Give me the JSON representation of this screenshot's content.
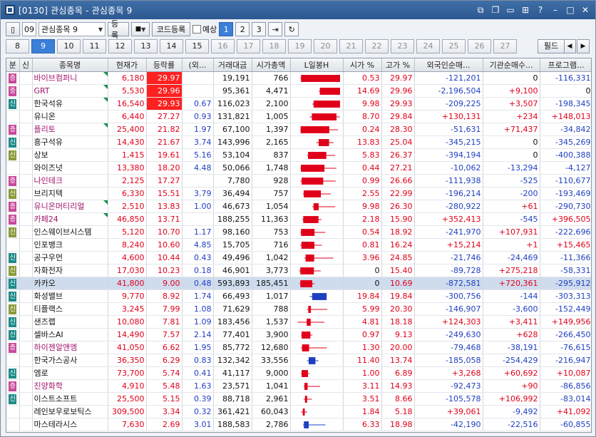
{
  "window": {
    "title": "[0130] 관심종목 - 관심종목 9"
  },
  "toolbar": {
    "group_no": "09",
    "group_name": "관심종목 9",
    "register_btn": "등록",
    "code_register_btn": "코드등록",
    "preview_label": "예상",
    "pages": [
      "1",
      "2",
      "3"
    ]
  },
  "tabs": [
    "8",
    "9",
    "10",
    "11",
    "12",
    "13",
    "14",
    "15",
    "16",
    "17",
    "18",
    "19",
    "20",
    "21",
    "22",
    "23",
    "24",
    "25",
    "26",
    "27"
  ],
  "filter_label": "필드",
  "colors": {
    "up": "#e0001a",
    "down": "#1f3fc0",
    "active": "#3b7fd9",
    "selected_row": "#cfdcee"
  },
  "columns": [
    "분",
    "신",
    "종목명",
    "현재가",
    "등락률",
    "(외...",
    "거래대금",
    "시가총액",
    "L일봉H",
    "시가 %",
    "고가 %",
    "외국인순매...",
    "기관순매수...",
    "프로그램..."
  ],
  "rows": [
    {
      "b": "증",
      "s": "",
      "name": "바이브컴퍼니",
      "price": "6,180",
      "rate": "29.97",
      "f": "",
      "amt": "19,191",
      "cap": "766",
      "o": "0.53",
      "h": "29.97",
      "fr": "-121,201",
      "inst": "0",
      "prog": "-116,331",
      "ohlc": [
        0.53,
        29.97,
        0.0,
        29.97
      ]
    },
    {
      "b": "증",
      "s": "",
      "name": "GRT",
      "price": "5,530",
      "rate": "29.96",
      "f": "",
      "amt": "95,361",
      "cap": "4,471",
      "o": "14.69",
      "h": "29.96",
      "fr": "-2,196,504",
      "inst": "+9,100",
      "prog": "0",
      "ohlc": [
        14.69,
        29.96,
        14.0,
        29.96
      ]
    },
    {
      "b": "신",
      "s": "",
      "name": "한국석유",
      "price": "16,540",
      "rate": "29.93",
      "f": "0.67",
      "amt": "116,023",
      "cap": "2,100",
      "o": "9.98",
      "h": "29.93",
      "fr": "-209,225",
      "inst": "+3,507",
      "prog": "-198,345",
      "ohlc": [
        9.98,
        29.93,
        9.0,
        29.93
      ]
    },
    {
      "b": "",
      "s": "",
      "name": "유니온",
      "price": "6,440",
      "rate": "27.27",
      "f": "0.93",
      "amt": "131,821",
      "cap": "1,005",
      "o": "8.70",
      "h": "29.84",
      "fr": "+130,131",
      "inst": "+234",
      "prog": "+148,013",
      "ohlc": [
        8.7,
        29.84,
        7.0,
        27.27
      ]
    },
    {
      "b": "증",
      "s": "",
      "name": "플리토",
      "price": "25,400",
      "rate": "21.82",
      "f": "1.97",
      "amt": "67,100",
      "cap": "1,397",
      "o": "0.24",
      "h": "28.30",
      "fr": "-51,631",
      "inst": "+71,437",
      "prog": "-34,842",
      "ohlc": [
        0.24,
        28.3,
        0.0,
        21.82
      ]
    },
    {
      "b": "신",
      "s": "",
      "name": "흥구석유",
      "price": "14,430",
      "rate": "21.67",
      "f": "3.74",
      "amt": "143,996",
      "cap": "2,165",
      "o": "13.83",
      "h": "25.04",
      "fr": "-345,215",
      "inst": "0",
      "prog": "-345,269",
      "ohlc": [
        13.83,
        25.04,
        12.0,
        21.67
      ]
    },
    {
      "b": "신",
      "s": "",
      "name": "상보",
      "price": "1,415",
      "rate": "19.61",
      "f": "5.16",
      "amt": "53,104",
      "cap": "837",
      "o": "5.83",
      "h": "26.37",
      "fr": "-394,194",
      "inst": "0",
      "prog": "-400,388",
      "ohlc": [
        5.83,
        26.37,
        5.0,
        19.61
      ]
    },
    {
      "b": "",
      "s": "",
      "name": "와이즈넛",
      "price": "13,380",
      "rate": "18.20",
      "f": "4.48",
      "amt": "50,066",
      "cap": "1,748",
      "o": "0.44",
      "h": "27.21",
      "fr": "-10,062",
      "inst": "-13,294",
      "prog": "-4,127",
      "ohlc": [
        0.44,
        27.21,
        0.0,
        18.2
      ]
    },
    {
      "b": "증",
      "s": "",
      "name": "나인테크",
      "price": "2,125",
      "rate": "17.27",
      "f": "",
      "amt": "7,780",
      "cap": "928",
      "o": "0.99",
      "h": "26.66",
      "fr": "-111,938",
      "inst": "-525",
      "prog": "-110,677",
      "ohlc": [
        0.99,
        26.66,
        0.0,
        17.27
      ]
    },
    {
      "b": "신",
      "s": "",
      "name": "브리지텍",
      "price": "6,330",
      "rate": "15.51",
      "f": "3.79",
      "amt": "36,494",
      "cap": "757",
      "o": "2.55",
      "h": "22.99",
      "fr": "-196,214",
      "inst": "-200",
      "prog": "-193,469",
      "ohlc": [
        2.55,
        22.99,
        2.0,
        15.51
      ]
    },
    {
      "b": "증",
      "s": "",
      "name": "유니온머티리얼",
      "price": "2,510",
      "rate": "13.83",
      "f": "1.00",
      "amt": "46,673",
      "cap": "1,054",
      "o": "9.98",
      "h": "26.30",
      "fr": "-280,922",
      "inst": "+61",
      "prog": "-290,730",
      "ohlc": [
        9.98,
        26.3,
        9.0,
        13.83
      ]
    },
    {
      "b": "증",
      "s": "",
      "name": "카페24",
      "price": "46,850",
      "rate": "13.71",
      "f": "",
      "amt": "188,255",
      "cap": "11,363",
      "o": "2.18",
      "h": "15.90",
      "fr": "+352,413",
      "inst": "-545",
      "prog": "+396,505",
      "ohlc": [
        2.18,
        15.9,
        1.5,
        13.71
      ]
    },
    {
      "b": "신",
      "s": "",
      "name": "인스웨이브시스템",
      "price": "5,120",
      "rate": "10.70",
      "f": "1.17",
      "amt": "98,160",
      "cap": "753",
      "o": "0.54",
      "h": "18.92",
      "fr": "-241,970",
      "inst": "+107,931",
      "prog": "-222,696",
      "ohlc": [
        0.54,
        18.92,
        0.0,
        10.7
      ]
    },
    {
      "b": "",
      "s": "",
      "name": "인포뱅크",
      "price": "8,240",
      "rate": "10.60",
      "f": "4.85",
      "amt": "15,705",
      "cap": "716",
      "o": "0.81",
      "h": "16.24",
      "fr": "+15,214",
      "inst": "+1",
      "prog": "+15,465",
      "ohlc": [
        0.81,
        16.24,
        0.0,
        10.6
      ]
    },
    {
      "b": "신",
      "s": "",
      "name": "공구우먼",
      "price": "4,600",
      "rate": "10.44",
      "f": "0.43",
      "amt": "49,496",
      "cap": "1,042",
      "o": "3.96",
      "h": "24.85",
      "fr": "-21,746",
      "inst": "-24,469",
      "prog": "-11,366",
      "ohlc": [
        3.96,
        24.85,
        3.0,
        10.44
      ]
    },
    {
      "b": "신",
      "s": "",
      "name": "자화전자",
      "price": "17,030",
      "rate": "10.23",
      "f": "0.18",
      "amt": "46,901",
      "cap": "3,773",
      "o": "0",
      "h": "15.40",
      "fr": "-89,728",
      "inst": "+275,218",
      "prog": "-58,331",
      "ohlc": [
        0.0,
        15.4,
        -1.0,
        10.23
      ]
    },
    {
      "b": "신",
      "s": "",
      "name": "카카오",
      "price": "41,800",
      "rate": "9.00",
      "f": "0.48",
      "amt": "593,893",
      "cap": "185,451",
      "o": "0",
      "h": "10.69",
      "fr": "-872,581",
      "inst": "+720,361",
      "prog": "-295,912",
      "ohlc": [
        0.0,
        10.69,
        -0.5,
        9.0
      ],
      "sel": true
    },
    {
      "b": "신",
      "s": "",
      "name": "화성밸브",
      "price": "9,770",
      "rate": "8.92",
      "f": "1.74",
      "amt": "66,493",
      "cap": "1,017",
      "o": "19.84",
      "h": "19.84",
      "fr": "-300,756",
      "inst": "-144",
      "prog": "-303,313",
      "ohlc": [
        19.84,
        19.84,
        7.0,
        8.92
      ]
    },
    {
      "b": "신",
      "s": "",
      "name": "티플랙스",
      "price": "3,245",
      "rate": "7.99",
      "f": "1.08",
      "amt": "71,629",
      "cap": "788",
      "o": "5.99",
      "h": "20.30",
      "fr": "-146,907",
      "inst": "-3,600",
      "prog": "-152,449",
      "ohlc": [
        5.99,
        20.3,
        5.0,
        7.99
      ]
    },
    {
      "b": "신",
      "s": "",
      "name": "샌즈랩",
      "price": "10,080",
      "rate": "7.81",
      "f": "1.09",
      "amt": "183,456",
      "cap": "1,537",
      "o": "4.81",
      "h": "18.18",
      "fr": "+124,303",
      "inst": "+3,411",
      "prog": "+149,956",
      "ohlc": [
        4.81,
        18.18,
        -2.0,
        7.81
      ]
    },
    {
      "b": "신",
      "s": "",
      "name": "셀바스AI",
      "price": "14,490",
      "rate": "7.57",
      "f": "2.14",
      "amt": "77,401",
      "cap": "3,900",
      "o": "0.97",
      "h": "9.13",
      "fr": "-249,630",
      "inst": "+628",
      "prog": "-266,450",
      "ohlc": [
        0.97,
        9.13,
        0.5,
        7.57
      ]
    },
    {
      "b": "증",
      "s": "",
      "name": "하이젠알앤엠",
      "price": "41,050",
      "rate": "6.62",
      "f": "1.95",
      "amt": "85,772",
      "cap": "12,680",
      "o": "1.30",
      "h": "20.00",
      "fr": "-79,468",
      "inst": "-38,191",
      "prog": "-76,615",
      "ohlc": [
        1.3,
        20.0,
        0.5,
        6.62
      ]
    },
    {
      "b": "",
      "s": "",
      "name": "한국가스공사",
      "price": "36,350",
      "rate": "6.29",
      "f": "0.83",
      "amt": "132,342",
      "cap": "33,556",
      "o": "11.40",
      "h": "13.74",
      "fr": "-185,058",
      "inst": "-254,429",
      "prog": "-216,947",
      "ohlc": [
        11.4,
        13.74,
        5.0,
        6.29
      ]
    },
    {
      "b": "신",
      "s": "",
      "name": "엠로",
      "price": "73,700",
      "rate": "5.74",
      "f": "0.41",
      "amt": "41,117",
      "cap": "9,000",
      "o": "1.00",
      "h": "6.89",
      "fr": "+3,268",
      "inst": "+60,692",
      "prog": "+10,087",
      "ohlc": [
        1.0,
        6.89,
        0.5,
        5.74
      ]
    },
    {
      "b": "증",
      "s": "",
      "name": "진양화학",
      "price": "4,910",
      "rate": "5.48",
      "f": "1.63",
      "amt": "23,571",
      "cap": "1,041",
      "o": "3.11",
      "h": "14.93",
      "fr": "-92,473",
      "inst": "+90",
      "prog": "-86,856",
      "ohlc": [
        3.11,
        14.93,
        2.5,
        5.48
      ]
    },
    {
      "b": "신",
      "s": "",
      "name": "이스트소프트",
      "price": "25,500",
      "rate": "5.15",
      "f": "0.39",
      "amt": "88,718",
      "cap": "2,961",
      "o": "3.51",
      "h": "8.66",
      "fr": "-105,578",
      "inst": "+106,992",
      "prog": "-83,014",
      "ohlc": [
        3.51,
        8.66,
        2.5,
        5.15
      ]
    },
    {
      "b": "",
      "s": "",
      "name": "레인보우로보틱스",
      "price": "309,500",
      "rate": "3.34",
      "f": "0.32",
      "amt": "361,421",
      "cap": "60,043",
      "o": "1.84",
      "h": "5.18",
      "fr": "+39,061",
      "inst": "-9,492",
      "prog": "+41,092",
      "ohlc": [
        1.84,
        5.18,
        0.5,
        3.34
      ]
    },
    {
      "b": "",
      "s": "",
      "name": "마스테라시스",
      "price": "7,630",
      "rate": "2.69",
      "f": "3.01",
      "amt": "188,583",
      "cap": "2,786",
      "o": "6.33",
      "h": "18.98",
      "fr": "-42,190",
      "inst": "-22,516",
      "prog": "-60,855",
      "ohlc": [
        6.33,
        18.98,
        2.0,
        2.69
      ]
    }
  ]
}
